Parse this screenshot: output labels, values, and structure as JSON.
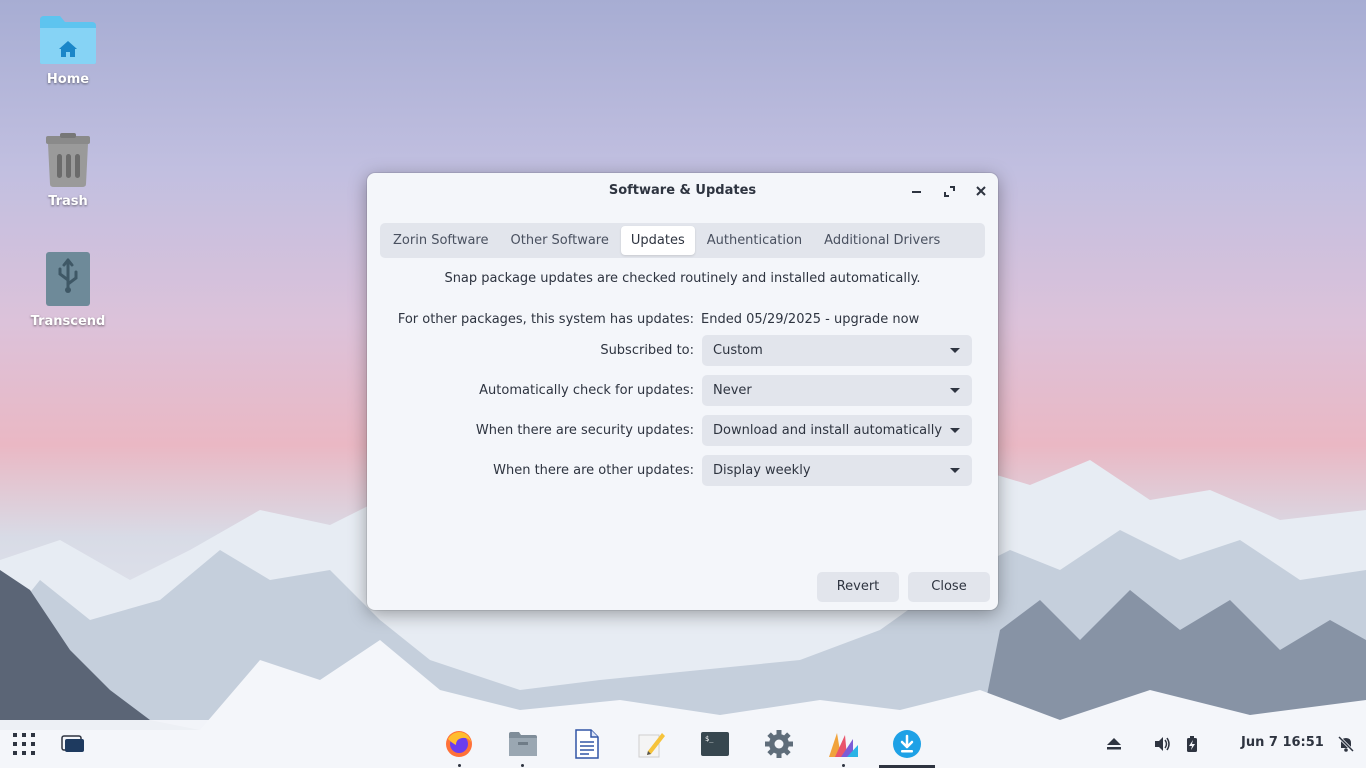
{
  "desktop": {
    "icons": [
      {
        "label": "Home"
      },
      {
        "label": "Trash"
      },
      {
        "label": "Transcend"
      }
    ]
  },
  "window": {
    "title": "Software & Updates",
    "tabs": [
      {
        "label": "Zorin Software"
      },
      {
        "label": "Other Software"
      },
      {
        "label": "Updates"
      },
      {
        "label": "Authentication"
      },
      {
        "label": "Additional Drivers"
      }
    ],
    "active_tab": "Updates",
    "snap_note": "Snap package updates are checked routinely and installed automatically.",
    "other_packages": {
      "label": "For other packages, this system has updates:",
      "value": "Ended 05/29/2025 - upgrade now"
    },
    "subscribed": {
      "label": "Subscribed to:",
      "value": "Custom"
    },
    "auto_check": {
      "label": "Automatically check for updates:",
      "value": "Never"
    },
    "security": {
      "label": "When there are security updates:",
      "value": "Download and install automatically"
    },
    "other_updates": {
      "label": "When there are other updates:",
      "value": "Display weekly"
    },
    "revert_label": "Revert",
    "close_label": "Close"
  },
  "taskbar": {
    "apps": [
      "zorin-menu-icon",
      "workspaces-icon",
      "firefox-icon",
      "files-icon",
      "writer-icon",
      "text-editor-icon",
      "terminal-icon",
      "settings-icon",
      "appearance-icon",
      "software-updater-icon"
    ],
    "clock": "Jun 7  16:51"
  },
  "colors": {
    "accent": "#1ea1e6",
    "window_bg": "#f4f6fa",
    "control_bg": "#e2e5ec"
  }
}
